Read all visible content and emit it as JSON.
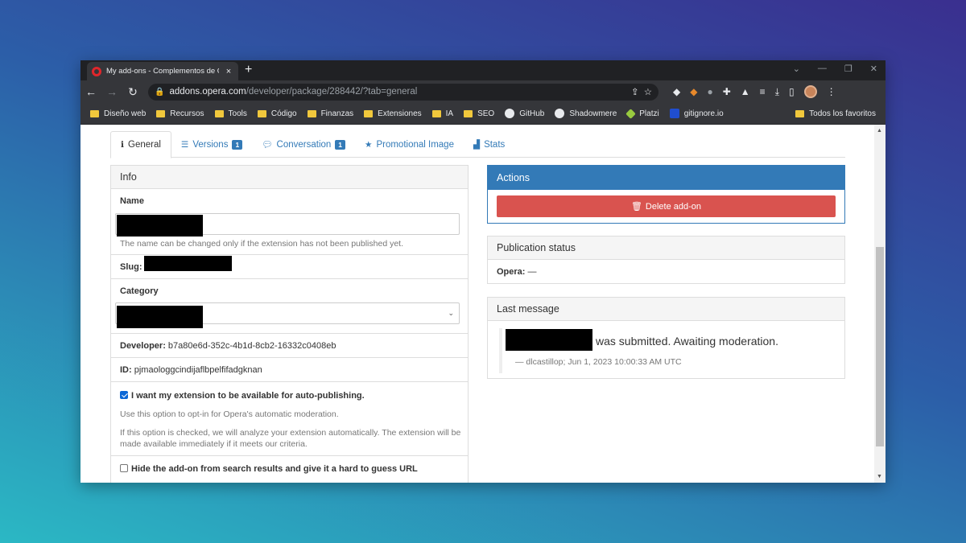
{
  "browser": {
    "tab_title": "My add-ons - Complementos de Opera",
    "tab_close": "×",
    "new_tab": "+",
    "url_host": "addons.opera.com",
    "url_path": "/developer/package/288442/?tab=general",
    "bookmarks": [
      "Diseño web",
      "Recursos",
      "Tools",
      "Código",
      "Finanzas",
      "Extensiones",
      "IA",
      "SEO",
      "GitHub",
      "Shadowmere",
      "Platzi",
      "gitignore.io"
    ],
    "all_bookmarks": "Todos los favoritos"
  },
  "tabs": [
    {
      "label": "General",
      "icon": "info-icon"
    },
    {
      "label": "Versions",
      "icon": "list-icon",
      "badge": "1"
    },
    {
      "label": "Conversation",
      "icon": "comment-icon",
      "badge": "1"
    },
    {
      "label": "Promotional Image",
      "icon": "star-icon"
    },
    {
      "label": "Stats",
      "icon": "chart-icon"
    }
  ],
  "info": {
    "heading": "Info",
    "name_label": "Name",
    "name_help": "The name can be changed only if the extension has not been published yet.",
    "slug_label": "Slug:",
    "category_label": "Category",
    "developer_label": "Developer:",
    "developer_value": "b7a80e6d-352c-4b1d-8cb2-16332c0408eb",
    "id_label": "ID:",
    "id_value": "pjmaologgcindijaflbpelfifadgknan",
    "autopublish_label": "I want my extension to be available for auto-publishing.",
    "autopublish_checked": true,
    "autopublish_help1": "Use this option to opt-in for Opera's automatic moderation.",
    "autopublish_help2": "If this option is checked, we will analyze your extension automatically. The extension will be made available immediately if it meets our criteria.",
    "hide_label": "Hide the add-on from search results and give it a hard to guess URL",
    "hide_checked": false
  },
  "actions": {
    "heading": "Actions",
    "delete_label": "Delete add-on"
  },
  "publication": {
    "heading": "Publication status",
    "opera_label": "Opera:",
    "opera_value": "—"
  },
  "last_message": {
    "heading": "Last message",
    "text": "was submitted. Awaiting moderation.",
    "footer": "— dlcastillop; Jun 1, 2023 10:00:33 AM UTC"
  },
  "colors": {
    "primary": "#337ab7",
    "danger": "#d9534f",
    "chrome_dark": "#35363a"
  }
}
